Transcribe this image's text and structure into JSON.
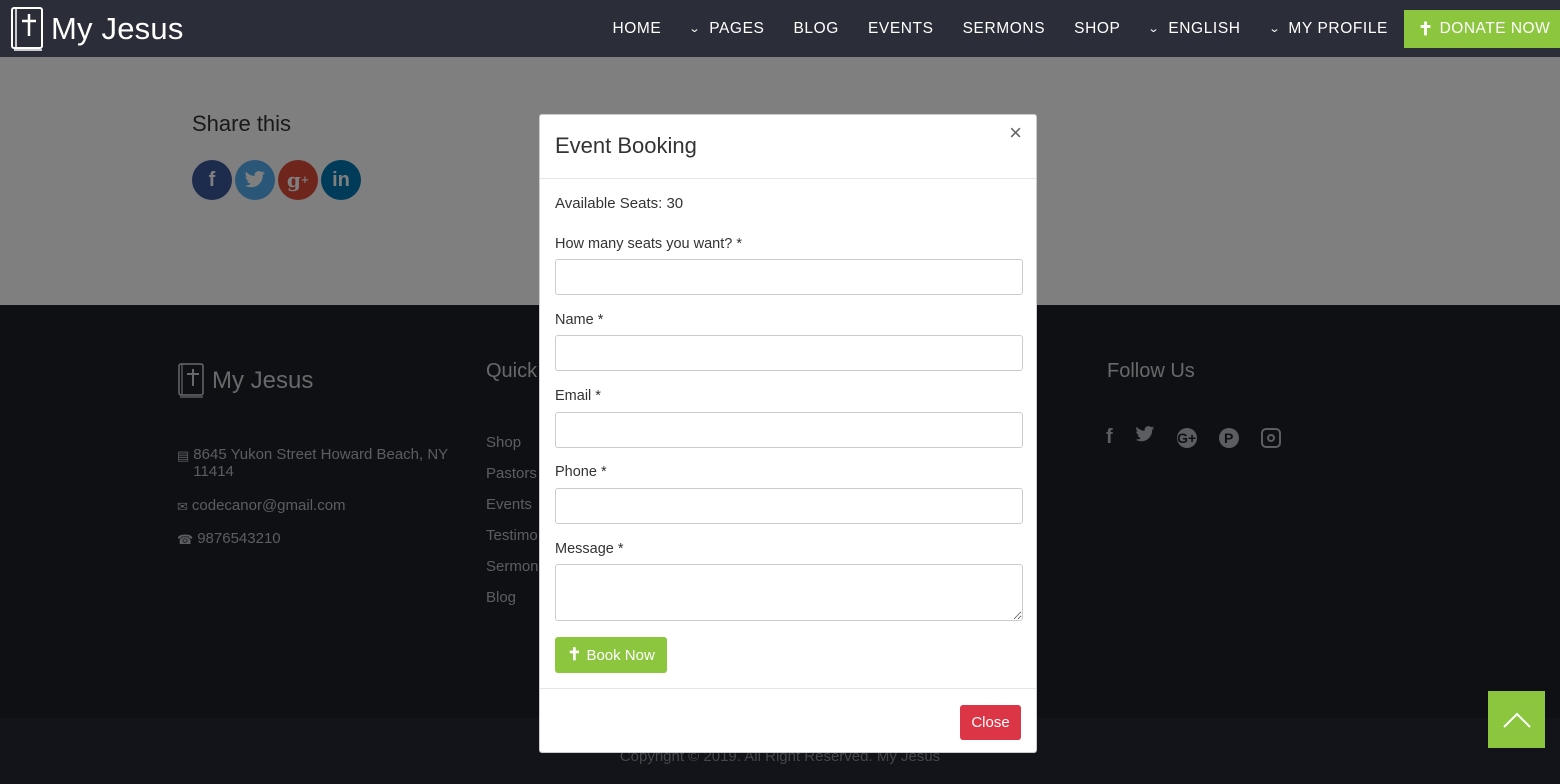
{
  "header": {
    "brand": "My Jesus",
    "nav": [
      {
        "label": "HOME",
        "dropdown": false
      },
      {
        "label": "PAGES",
        "dropdown": true
      },
      {
        "label": "BLOG",
        "dropdown": false
      },
      {
        "label": "EVENTS",
        "dropdown": false
      },
      {
        "label": "SERMONS",
        "dropdown": false
      },
      {
        "label": "SHOP",
        "dropdown": false
      },
      {
        "label": "ENGLISH",
        "dropdown": true
      },
      {
        "label": "MY PROFILE",
        "dropdown": true
      }
    ],
    "donate_label": "DONATE NOW"
  },
  "share": {
    "title": "Share this",
    "buttons": [
      "facebook-icon",
      "twitter-icon",
      "google-plus-icon",
      "linkedin-icon"
    ]
  },
  "footer": {
    "brand": "My Jesus",
    "address": "8645 Yukon Street Howard Beach, NY 11414",
    "email": "codecanor@gmail.com",
    "phone": "9876543210",
    "quick_title": "Quick",
    "quick_links": [
      "Shop",
      "Pastors",
      "Events",
      "Testimo",
      "Sermons",
      "Blog"
    ],
    "follow_title": "Follow Us",
    "social": [
      "facebook-icon",
      "twitter-icon",
      "google-plus-icon",
      "pinterest-icon",
      "instagram-icon"
    ],
    "copyright": "Copyright © 2019. All Right Reserved. My Jesus"
  },
  "modal": {
    "title": "Event Booking",
    "available_seats": "Available Seats: 30",
    "fields": [
      {
        "label": "How many seats you want? *",
        "value": ""
      },
      {
        "label": "Name *",
        "value": ""
      },
      {
        "label": "Email *",
        "value": ""
      },
      {
        "label": "Phone *",
        "value": ""
      },
      {
        "label": "Message *",
        "value": ""
      }
    ],
    "book_label": "Book Now",
    "close_label": "Close"
  },
  "colors": {
    "accent": "#8cc63e",
    "danger": "#dc3545",
    "navbar": "#2b2e38",
    "footer": "#1e2029"
  }
}
